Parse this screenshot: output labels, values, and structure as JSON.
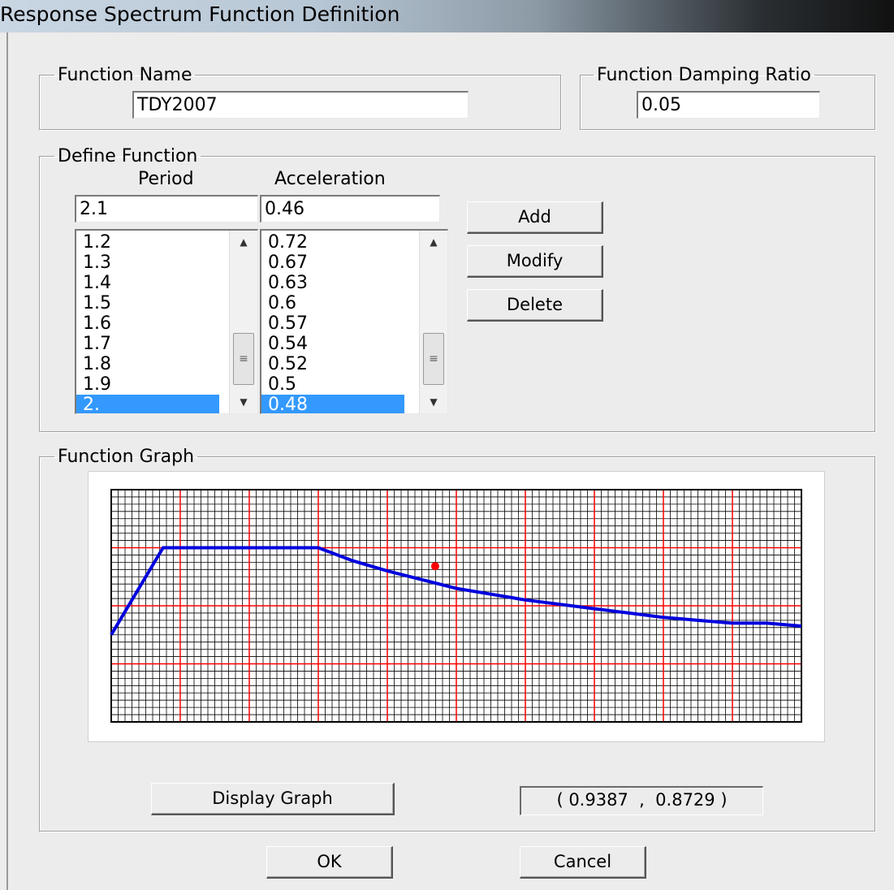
{
  "window": {
    "title": "Response Spectrum  Function Definition"
  },
  "function_name": {
    "legend": "Function Name",
    "value": "TDY2007"
  },
  "damping": {
    "legend": "Function Damping Ratio",
    "value": "0.05"
  },
  "define_function": {
    "legend": "Define Function",
    "period_header": "Period",
    "acceleration_header": "Acceleration",
    "period_input": "2.1",
    "acceleration_input": "0.46",
    "periods": [
      "1.2",
      "1.3",
      "1.4",
      "1.5",
      "1.6",
      "1.7",
      "1.8",
      "1.9",
      "2."
    ],
    "accelerations": [
      "0.72",
      "0.67",
      "0.63",
      "0.6",
      "0.57",
      "0.54",
      "0.52",
      "0.5",
      "0.48"
    ],
    "selected_index": 8,
    "add_label": "Add",
    "modify_label": "Modify",
    "delete_label": "Delete"
  },
  "graph": {
    "legend": "Function Graph",
    "display_label": "Display Graph",
    "coordinate_readout": "( 0.9387  ,  0.8729 )"
  },
  "footer": {
    "ok_label": "OK",
    "cancel_label": "Cancel"
  },
  "chart_data": {
    "type": "line",
    "x": [
      0,
      0.15,
      0.6,
      0.7,
      0.8,
      0.9,
      1.0,
      1.1,
      1.2,
      1.3,
      1.4,
      1.5,
      1.6,
      1.7,
      1.8,
      1.9,
      2.0
    ],
    "y": [
      0.4,
      1.0,
      1.0,
      0.91,
      0.84,
      0.78,
      0.72,
      0.68,
      0.64,
      0.61,
      0.58,
      0.55,
      0.52,
      0.5,
      0.48,
      0.48,
      0.46
    ],
    "xlim": [
      0,
      2
    ],
    "ylim": [
      -0.2,
      1.4
    ],
    "grid": true,
    "marker": {
      "x": 0.9387,
      "y": 0.8729
    },
    "colors": {
      "line": "#0000dd",
      "major_grid": "#ff0000",
      "minor_grid": "#000000",
      "marker": "#ff0000"
    }
  }
}
